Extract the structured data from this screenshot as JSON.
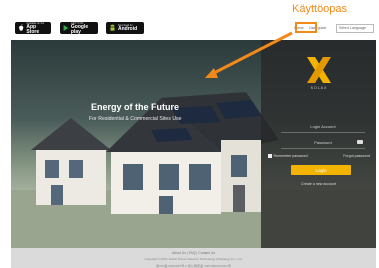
{
  "annotation": {
    "label": "Käyttöopas",
    "color": "#f28a1a"
  },
  "header": {
    "app_store": {
      "small": "Available on the",
      "main": "App Store"
    },
    "google_play": {
      "small": "GET IT ON",
      "main": "Google play"
    },
    "android": {
      "small": "Download for",
      "main": "Android"
    },
    "link_home": "Home",
    "link_user_guide": "User guide",
    "language_placeholder": "Select Language"
  },
  "hero": {
    "title": "Energy of the Future",
    "subtitle": "For Residential & Commercial Sites Use"
  },
  "login": {
    "logo_text": "SOLAX",
    "account_placeholder": "Login Account",
    "password_placeholder": "Password",
    "remember_label": "Remember password",
    "forgot_label": "Forgot password",
    "login_button": "Login",
    "create_account": "Create a new account"
  },
  "footer": {
    "links": "About Us  |  FAQ  |  Contact Us",
    "copyright": "Copyright ©2021 SolaX Power Network Technology (Zhejiang) Co., Ltd.",
    "icp": "浙ICP备19002845号-2  浙公网安备 33010602011021号"
  },
  "colors": {
    "accent": "#f2b400",
    "panel": "#282828",
    "annotation": "#f28a1a"
  }
}
